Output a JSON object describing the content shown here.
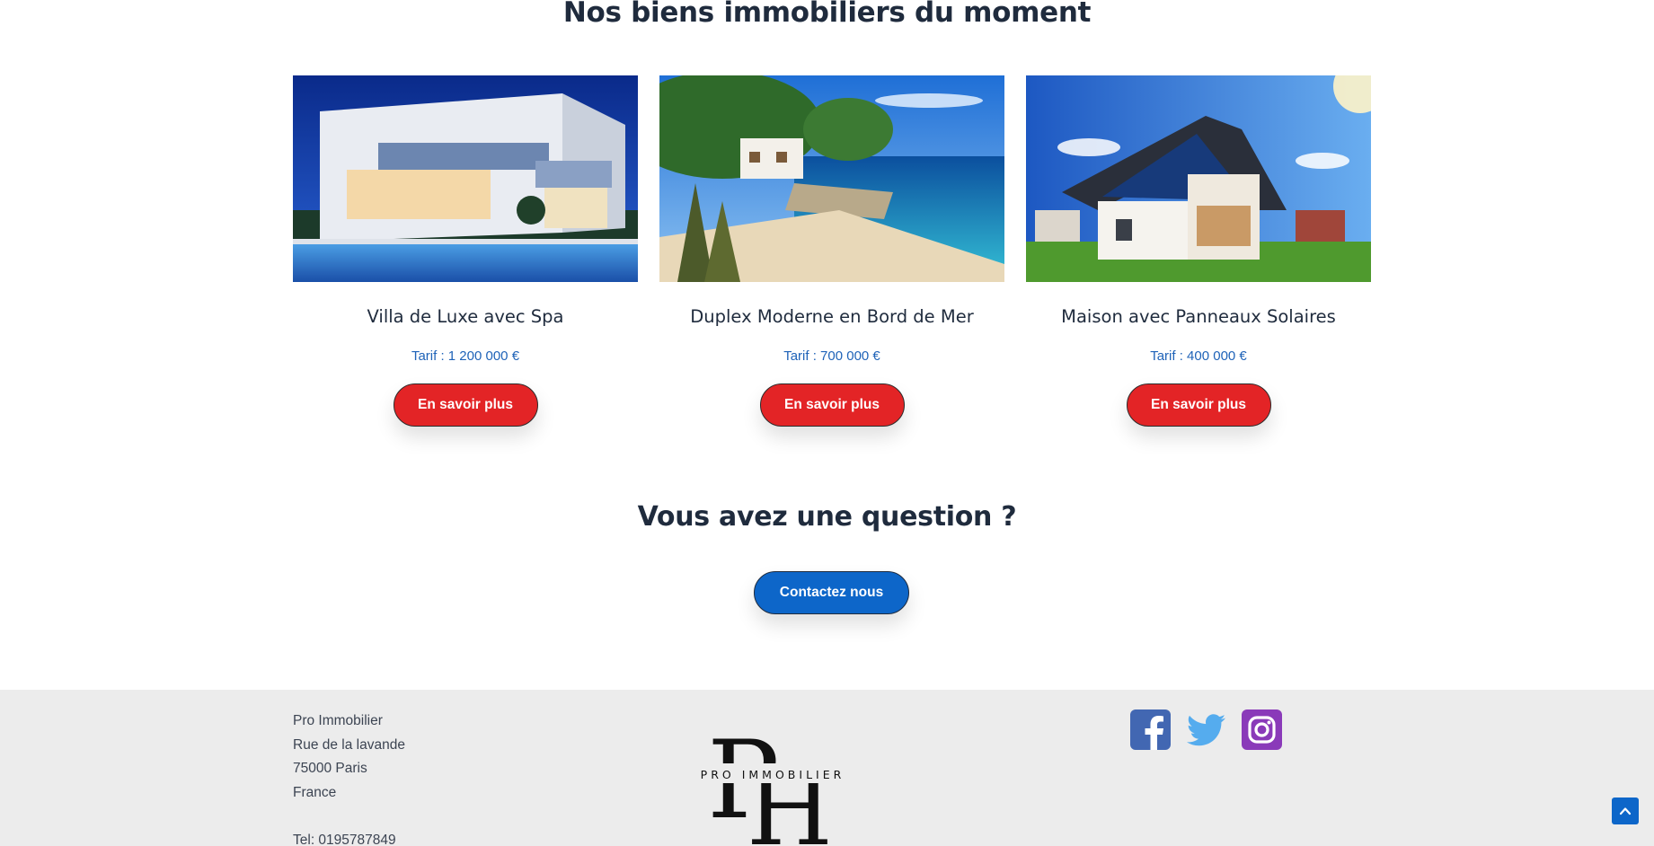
{
  "featured": {
    "title": "Nos biens immobiliers du moment",
    "properties": [
      {
        "name": "Villa de Luxe avec Spa",
        "price": "Tarif : 1 200 000 €",
        "button": "En savoir plus"
      },
      {
        "name": "Duplex Moderne en Bord de Mer",
        "price": "Tarif : 700 000 €",
        "button": "En savoir plus"
      },
      {
        "name": "Maison avec Panneaux Solaires",
        "price": "Tarif : 400 000 €",
        "button": "En savoir plus"
      }
    ]
  },
  "question": {
    "title": "Vous avez une question ?",
    "button": "Contactez nous"
  },
  "footer": {
    "address": {
      "company": "Pro Immobilier",
      "street": "Rue de la lavande",
      "city": "75000 Paris",
      "country": "France",
      "phone": "Tel: 0195787849"
    },
    "logo_text": "PRO IMMOBILIER",
    "socials": [
      "facebook-icon",
      "twitter-icon",
      "instagram-icon"
    ]
  },
  "colors": {
    "accent_red": "#e32426",
    "accent_blue": "#0d66c9",
    "price_blue": "#1f63b8",
    "footer_bg": "#ececec",
    "facebook": "#4267b2",
    "twitter": "#55acee",
    "instagram": "#8a3ab9"
  }
}
